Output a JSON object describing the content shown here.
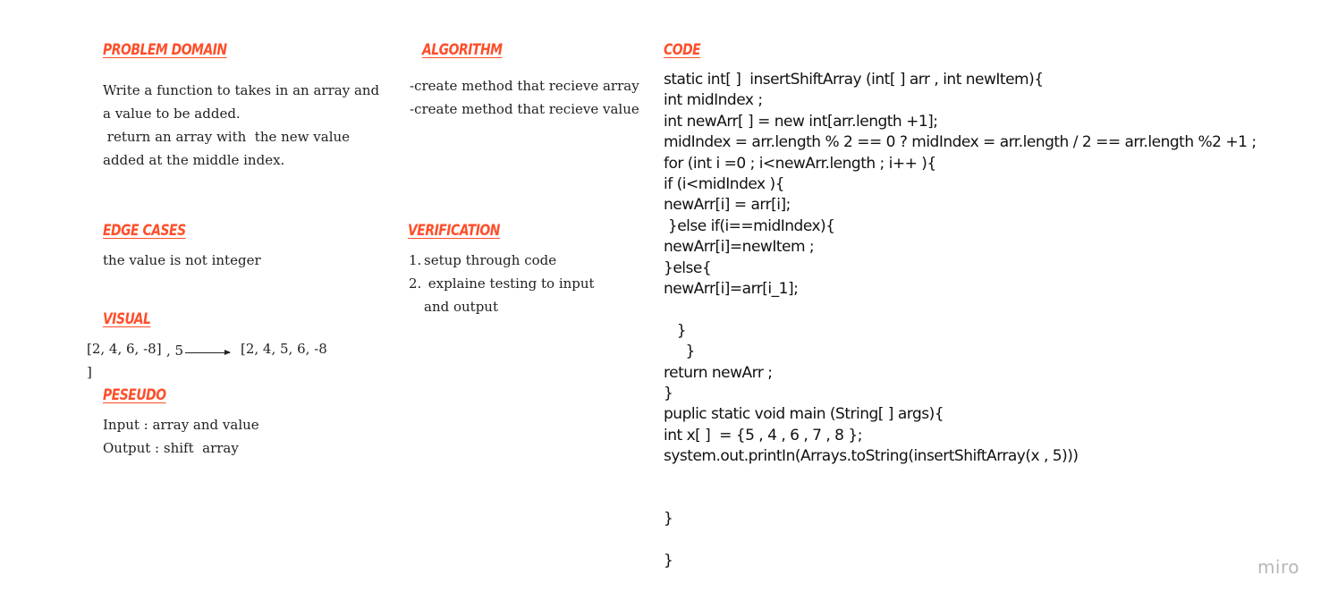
{
  "problem_domain": {
    "heading": "PROBLEM DOMAIN",
    "lines": [
      "Write a function to  takes in an array and",
      "a value to be added.",
      " return an array with  the new value",
      "added at the middle index."
    ]
  },
  "algorithm": {
    "heading": "ALGORITHM",
    "lines": [
      "-create method that recieve array",
      "-create method that recieve value"
    ]
  },
  "edge_cases": {
    "heading": "EDGE CASES",
    "text": "the value is not integer"
  },
  "verification": {
    "heading": "VERIFICATION",
    "items": [
      {
        "num": "1.",
        "lines": [
          "setup through code"
        ]
      },
      {
        "num": "2.",
        "lines": [
          " explaine testing to input",
          "and output"
        ]
      }
    ]
  },
  "visual": {
    "heading": "VISUAL",
    "input": "[2, 4, 6, -8]",
    "input_close": "]",
    "value": ", 5",
    "output": "[2, 4, 5, 6, -8"
  },
  "pseudo": {
    "heading": "PESEUDO",
    "lines": [
      "Input : array and value",
      "Output : shift  array"
    ]
  },
  "code": {
    "heading": "CODE",
    "lines": [
      "static int[ ]  insertShiftArray (int[ ] arr , int newItem){",
      "int midIndex ;",
      "int newArr[ ] = new int[arr.length +1];",
      "midIndex = arr.length % 2 == 0 ? midIndex = arr.length / 2 == arr.length %2 +1 ;",
      "for (int i =0 ; i<newArr.length ; i++ ){",
      "if (i<midIndex ){",
      "newArr[i] = arr[i];",
      " }else if(i==midIndex){",
      "newArr[i]=newItem ;",
      "}else{",
      "newArr[i]=arr[i_1];",
      "",
      "   }",
      "     }",
      "return newArr ;",
      "}",
      "puplic static void main (String[ ] args){",
      "int x[ ]  = {5 , 4 , 6 , 7 , 8 };",
      "system.out.printIn(Arrays.toString(insertShiftArray(x , 5)))",
      "",
      "",
      "}",
      "",
      "}"
    ]
  },
  "watermark": "miro",
  "colors": {
    "heading": "#ff4e2a",
    "text": "#222222",
    "watermark": "#b7b7b7",
    "background": "#ffffff"
  }
}
